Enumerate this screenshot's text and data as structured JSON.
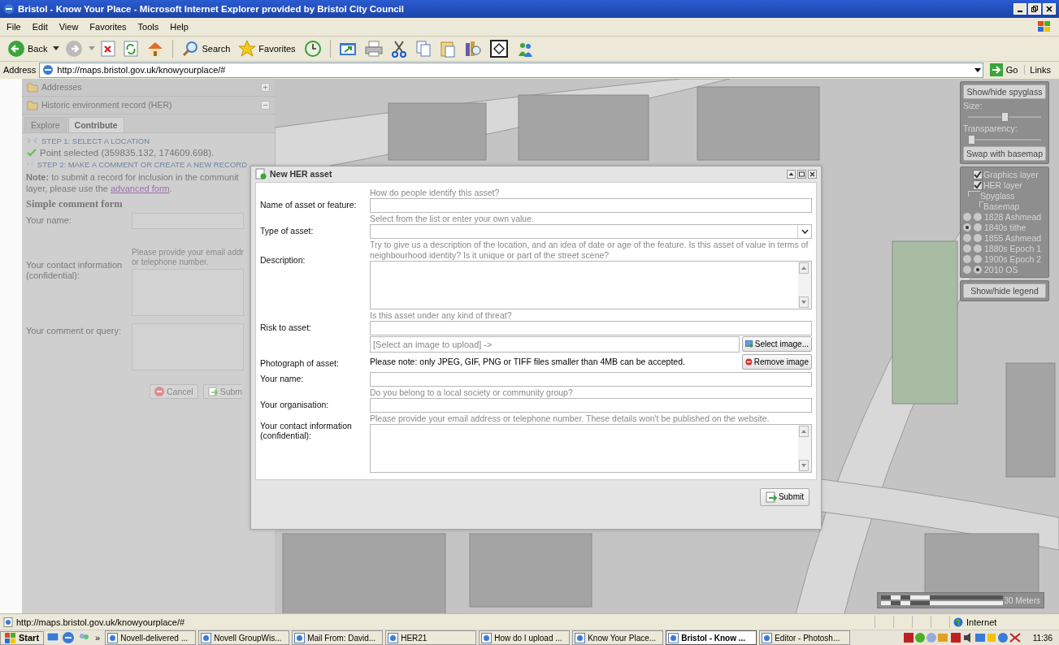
{
  "window": {
    "title": "Bristol - Know Your Place - Microsoft Internet Explorer provided by Bristol City Council"
  },
  "menu": [
    "File",
    "Edit",
    "View",
    "Favorites",
    "Tools",
    "Help"
  ],
  "toolbar": {
    "back": "Back",
    "search": "Search",
    "favorites": "Favorites"
  },
  "address": {
    "label": "Address",
    "url": "http://maps.bristol.gov.uk/knowyourplace/#",
    "go": "Go",
    "links": "Links"
  },
  "sidebar": {
    "panels": [
      {
        "title": "Addresses",
        "expanded": false
      },
      {
        "title": "Historic environment record (HER)",
        "expanded": true
      }
    ],
    "tabs": [
      {
        "label": "Explore",
        "selected": false
      },
      {
        "label": "Contribute",
        "selected": true
      }
    ],
    "step1": "STEP 1: SELECT A LOCATION",
    "point": "Point selected (359835.132, 174609.698).",
    "step2": "STEP 2: MAKE A COMMENT OR CREATE A NEW RECORD",
    "note": [
      "**Note:** to submit a record for inclusion in the communit",
      "layer, please use the"
    ],
    "note_link": "advanced form",
    "note_end": ".",
    "form_title": "Simple comment form",
    "fields": [
      {
        "label": "Your name:",
        "kind": "text"
      },
      {
        "label": "Your contact information (confidential):",
        "kind": "textarea",
        "hint": [
          "Please provide your email addr",
          "or telephone number."
        ]
      },
      {
        "label": "Your comment or query:",
        "kind": "textarea"
      }
    ],
    "cancel": "Cancel",
    "submit": "Subm"
  },
  "dialog": {
    "title": "New HER asset",
    "fields": [
      {
        "label": "Name of asset or feature:",
        "hint": "How do people identify this asset?",
        "kind": "text"
      },
      {
        "label": "Type of asset:",
        "hint": "Select from the list or enter your own value.",
        "kind": "combo"
      },
      {
        "label": "Description:",
        "hint": "Try to give us a description of the location, and an idea of date or age of the feature. Is this asset of value in terms of neighbourhood identity? Is it unique or part of the street scene?",
        "kind": "textarea"
      },
      {
        "label": "Risk to asset:",
        "hint": "Is this asset under any kind of threat?",
        "kind": "text"
      },
      {
        "label": "Photograph of asset:",
        "kind": "file",
        "placeholder": "[Select an image to upload] ->",
        "note": "Please note: only JPEG, GIF, PNG or TIFF files smaller than 4MB can be accepted.",
        "select": "Select image...",
        "remove": "Remove image"
      },
      {
        "label": "Your name:",
        "kind": "text"
      },
      {
        "label": "Your organisation:",
        "hint": "Do you belong to a local society or community group?",
        "kind": "text"
      },
      {
        "label": "Your contact information (confidential):",
        "hint": "Please provide your email address or telephone number. These details won't be published on the website.",
        "kind": "textarea"
      }
    ],
    "submit": "Submit"
  },
  "spyglass": {
    "toggle": "Show/hide spyglass",
    "size_label": "Size:",
    "size": {
      "level": 0.5
    },
    "transparency_label": "Transparency:",
    "transparency": {
      "level": 0.0
    },
    "swap": "Swap with basemap",
    "layers": [
      {
        "label": "Graphics layer",
        "checked": true
      },
      {
        "label": "HER layer",
        "checked": true
      }
    ],
    "spyglass_label": "Spyglass",
    "basemap_label": "Basemap",
    "maps": [
      {
        "label": "1828 Ashmead",
        "spyglass_selected": false,
        "basemap_selected": false
      },
      {
        "label": "1840s tithe",
        "spyglass_selected": true,
        "basemap_selected": false
      },
      {
        "label": "1855 Ashmead",
        "spyglass_selected": false,
        "basemap_selected": false
      },
      {
        "label": "1880s Epoch 1",
        "spyglass_selected": false,
        "basemap_selected": false
      },
      {
        "label": "1900s Epoch 2",
        "spyglass_selected": false,
        "basemap_selected": false
      },
      {
        "label": "2010 OS",
        "spyglass_selected": false,
        "basemap_selected": true
      }
    ],
    "legend": "Show/hide legend"
  },
  "scale": "30 Meters",
  "status_bar": {
    "url": "http://maps.bristol.gov.uk/knowyourplace/#",
    "zone": "Internet"
  },
  "taskbar": {
    "start": "Start",
    "more": "»",
    "tasks": [
      {
        "label": "Novell-delivered ...",
        "selected": false
      },
      {
        "label": "Novell GroupWis...",
        "selected": false
      },
      {
        "label": "Mail From: David...",
        "selected": false
      },
      {
        "label": "HER21",
        "selected": false
      },
      {
        "label": "How do I upload ...",
        "selected": false
      },
      {
        "label": "Know Your Place...",
        "selected": false
      },
      {
        "label": "Bristol - Know ...",
        "selected": true
      },
      {
        "label": "Editor - Photosh...",
        "selected": false
      }
    ],
    "time": "11:36"
  }
}
